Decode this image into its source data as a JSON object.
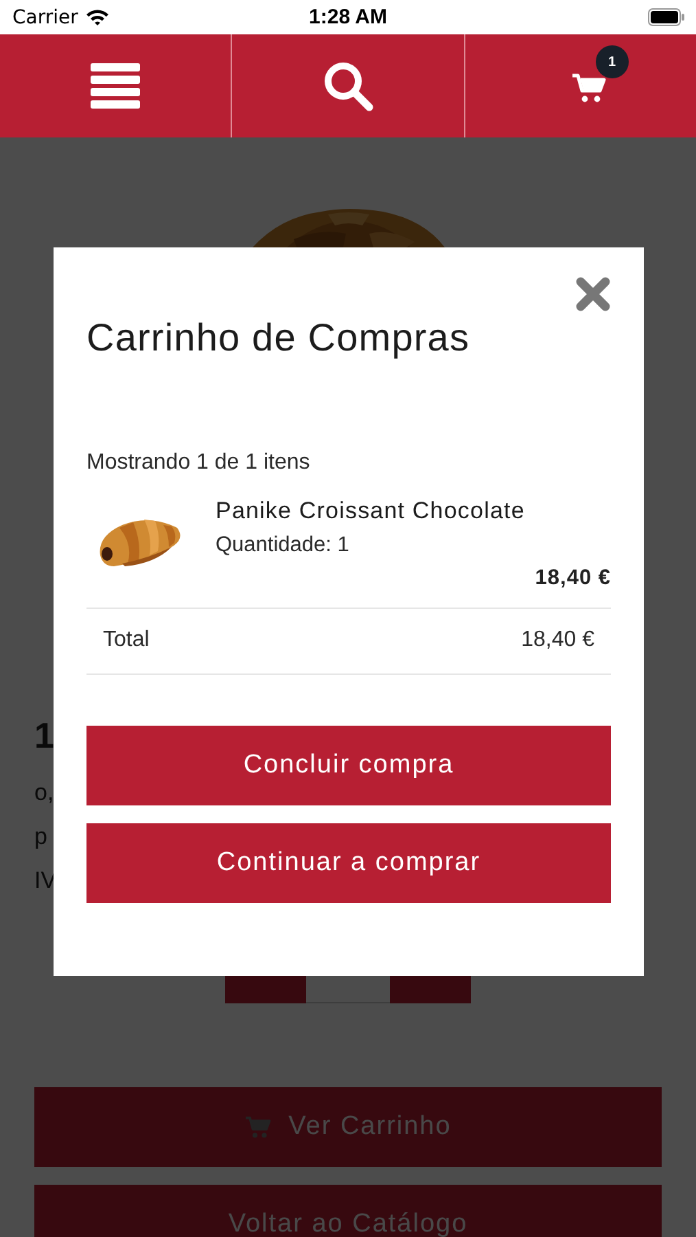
{
  "status_bar": {
    "carrier": "Carrier",
    "time": "1:28 AM"
  },
  "nav_bar": {
    "cart_badge": "1"
  },
  "product_page": {
    "price_fragment": "1",
    "text_fragments": [
      "o,",
      "p",
      "IV"
    ],
    "buttons": [
      {
        "label": "Ver Carrinho",
        "kind": "cart"
      },
      {
        "label": "Voltar ao Catálogo",
        "kind": "plain"
      }
    ]
  },
  "cart_modal": {
    "title": "Carrinho de Compras",
    "summary": "Mostrando 1 de 1 itens",
    "items": [
      {
        "name": "Panike Croissant Chocolate",
        "quantity": "Quantidade: 1",
        "price": "18,40 €"
      }
    ],
    "total_label": "Total",
    "total_value": "18,40 €",
    "buttons": [
      "Concluir compra",
      "Continuar a comprar"
    ]
  }
}
